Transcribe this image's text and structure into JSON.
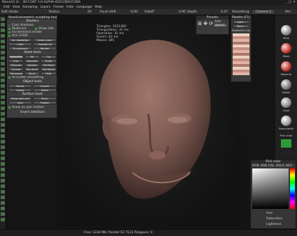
{
  "title": "Mana10.3c - 3D-COAT 3.0-ALPHA-42(CUDA)/CUDA",
  "window_controls": {
    "minimize": "_",
    "maximize": "□",
    "close": "✕"
  },
  "menu": [
    "Edit",
    "View",
    "Sampling",
    "Layers",
    "Freeze",
    "Hide",
    "Language",
    "Help"
  ],
  "toolbar": {
    "brush": "Soft stroke",
    "radius_label": "Radius",
    "radius_value": "20",
    "focal_label": "Focal shift",
    "focal_value": "0.00",
    "falloff_label": "Falloff",
    "falloff_value": "0.95",
    "depth_label": "Depth",
    "depth_value": "0.47",
    "smoothing_label": "Smoothing",
    "pen_label": "Pen"
  },
  "camera_label": "Camera 2",
  "panel": {
    "header": "Voxel/volumetric sculpting tool",
    "section": "Shaders",
    "options": [
      {
        "label": "Cast shadows",
        "checked": false
      },
      {
        "label": "Multicore",
        "checked": true
      },
      {
        "label": "Show info",
        "checked": true
      },
      {
        "label": "Incremental render",
        "checked": true
      },
      {
        "label": "Use CUDA",
        "checked": true
      }
    ],
    "inc_resolution": "Inc resolution",
    "symm_copy": "Symm copy",
    "clear": "Clear",
    "smooth_all": "Smooth all",
    "to_polygons": "To polygons",
    "render": "Render",
    "voxel_tools_header": "Voxel tools",
    "voxel_tools": [
      "Spres/Pla",
      "Fill",
      "Cut",
      "Clay",
      "Airbrush",
      "Build",
      "Extrude",
      "Sphere",
      "2D-Paint",
      "Scrape",
      "Vox pinch",
      "Vox follow",
      "Transpose",
      "Move",
      "Hide"
    ],
    "accurate_smoothing": "Accurate smoothing",
    "object_tools_header": "Object tools",
    "object_tools": [
      "Merge",
      "Curves",
      "Snake",
      "Splice"
    ],
    "surface_tools_header": "Surface tools",
    "surface_tools": [
      "Draw with pen",
      "Pinch",
      "Inoh",
      "Flatten"
    ],
    "snow_on_pen": "Snow on pen motion",
    "invert_selection": "Invert selection"
  },
  "stats": [
    "Triangles: 1021482",
    "Triangulation: 31 ms",
    "Operation: 31 ms",
    "Summ: 62 ms",
    "Meses: 345"
  ],
  "presets": {
    "header": "Presets",
    "add_preset": "Add preset",
    "options": "Options"
  },
  "palette": {
    "header": "Palette (F1)",
    "load": "Load...",
    "save": "Save...",
    "file": "PaletteGen ColorLaco"
  },
  "right_panel": [
    "Strip",
    "Mask",
    "Material",
    "Depth",
    "Color",
    "Specularity",
    "Pick color"
  ],
  "pick_color": {
    "title": "Pick color",
    "tabs": [
      "RGB",
      "HSB",
      "HSL",
      "HSLA",
      "HEX"
    ],
    "rows": [
      "Hue",
      "Saturation",
      "Lightness"
    ]
  },
  "status": "Free: 1234 Mb; Pointer:52 7121 Polygons: 0",
  "colors": {
    "skin": "#7a5850",
    "accent": "#3c9b3a",
    "panel": "#3d3d3d"
  }
}
